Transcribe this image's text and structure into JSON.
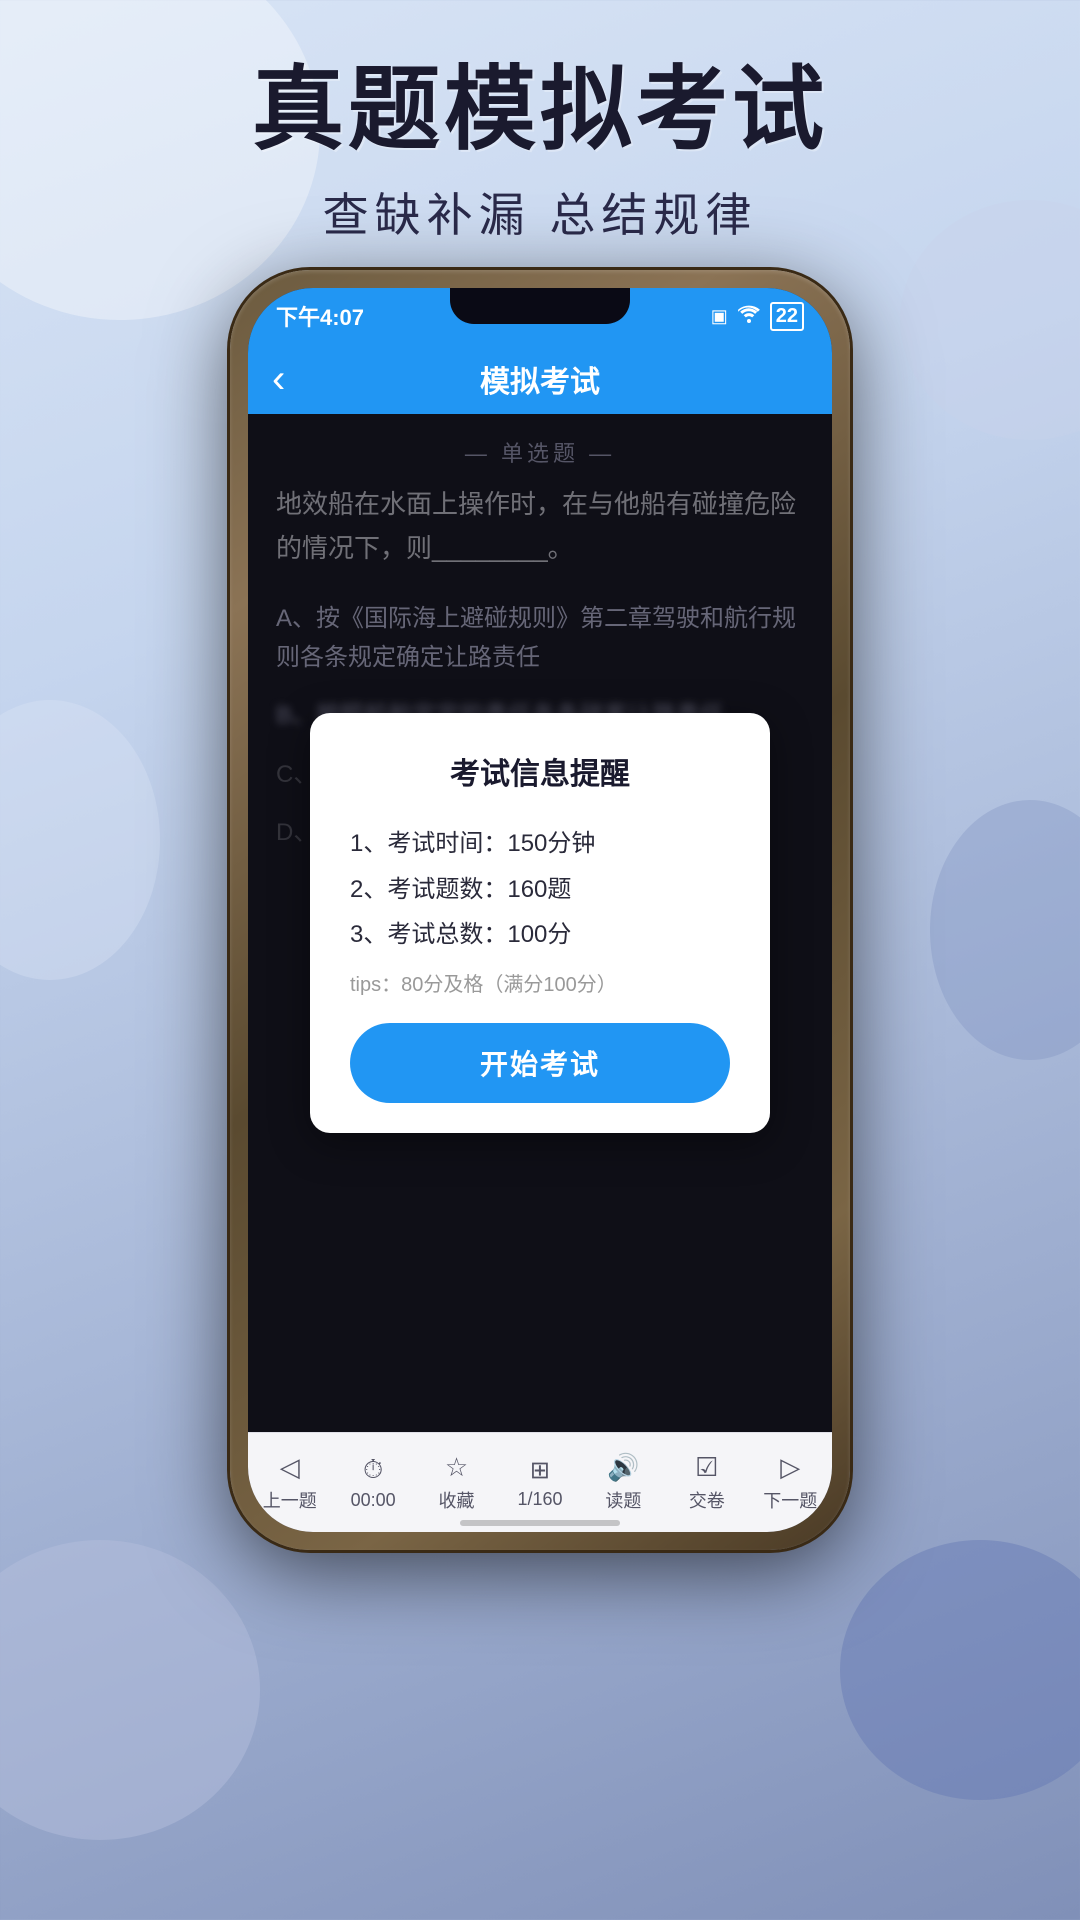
{
  "page": {
    "background": "#c5d5ee"
  },
  "header": {
    "main_title": "真题模拟考试",
    "sub_title": "查缺补漏 总结规律"
  },
  "phone": {
    "status_bar": {
      "time": "下午4:07",
      "icons": [
        "□",
        "WiFi",
        "22"
      ]
    },
    "nav": {
      "back_icon": "‹",
      "title": "模拟考试"
    },
    "content": {
      "section_label": "— 单选题 —",
      "question_text": "地效船在水面上操作时，在与他船有碰撞危险的情况下，则________。",
      "option_a": "A、按《国际海上避碰规则》第二章驾驶和航行规则各条规定确定让路责任",
      "option_b": "B、按照船舶定定的责任各条碰客让路责任",
      "option_c": "C、",
      "option_d": "D、"
    },
    "modal": {
      "title": "考试信息提醒",
      "items": [
        "1、考试时间：150分钟",
        "2、考试题数：160题",
        "3、考试总数：100分"
      ],
      "tip": "tips：80分及格（满分100分）",
      "button_label": "开始考试"
    },
    "toolbar": {
      "items": [
        {
          "icon": "◁",
          "label": "上一题"
        },
        {
          "icon": "⏱",
          "label": "00:00"
        },
        {
          "icon": "☆",
          "label": "收藏"
        },
        {
          "icon": "⊞",
          "label": "1/160"
        },
        {
          "icon": "◉)",
          "label": "读题"
        },
        {
          "icon": "☑",
          "label": "交卷"
        },
        {
          "icon": "▷",
          "label": "下一题"
        }
      ]
    }
  }
}
